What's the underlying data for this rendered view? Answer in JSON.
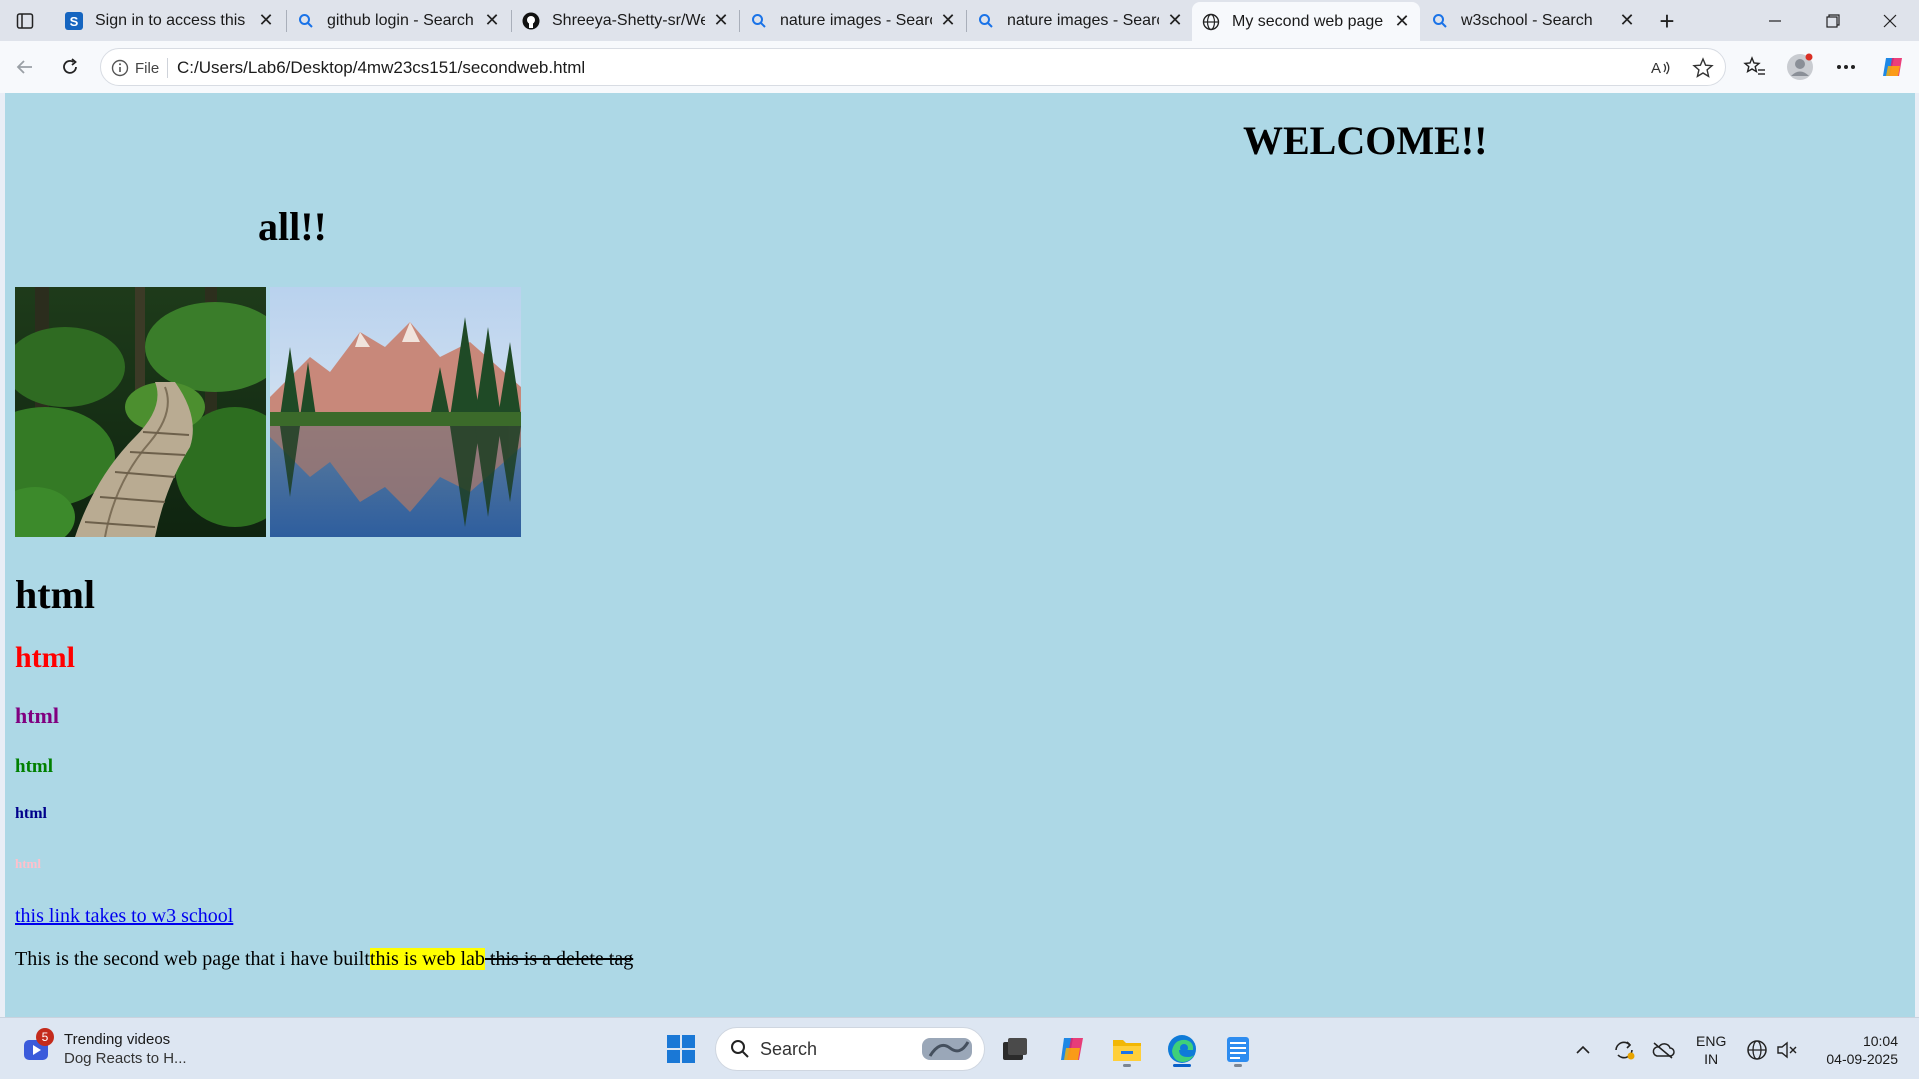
{
  "browser": {
    "tabs": [
      {
        "title": "Sign in to access this n",
        "icon": "s-logo-icon",
        "active": false
      },
      {
        "title": "github login - Search",
        "icon": "search-icon",
        "active": false
      },
      {
        "title": "Shreeya-Shetty-sr/Wel",
        "icon": "github-icon",
        "active": false
      },
      {
        "title": "nature images - Search",
        "icon": "search-icon",
        "active": false
      },
      {
        "title": "nature images - Searc",
        "icon": "search-icon",
        "active": false
      },
      {
        "title": "My second web page",
        "icon": "globe-icon",
        "active": true
      },
      {
        "title": "w3school - Search",
        "icon": "search-icon",
        "active": false
      }
    ],
    "site_info_label": "File",
    "url": "C:/Users/Lab6/Desktop/4mw23cs151/secondweb.html"
  },
  "page": {
    "background": "#add8e6",
    "welcome": "WELCOME!!",
    "all": "all!!",
    "images": [
      {
        "name": "forest-boardwalk-image"
      },
      {
        "name": "mountain-lake-reflection-image"
      }
    ],
    "headings": {
      "h1": "html",
      "h2": "html",
      "h3": "html",
      "h4": "html",
      "h5": "html",
      "h6": "html"
    },
    "heading_colors": {
      "h2": "#ff0000",
      "h3": "#800080",
      "h4": "#008000",
      "h5": "#00008b",
      "h6": "#ffc0cb"
    },
    "link_text": "this link takes to w3 school",
    "paragraph": {
      "text": "This is the second web page that i have built",
      "highlight": "this is web lab",
      "deleted": " this is a delete tag"
    }
  },
  "taskbar": {
    "widget": {
      "badge": "5",
      "title": "Trending videos",
      "subtitle": "Dog Reacts to H..."
    },
    "search_label": "Search",
    "lang_line1": "ENG",
    "lang_line2": "IN",
    "time": "10:04",
    "date": "04-09-2025"
  }
}
